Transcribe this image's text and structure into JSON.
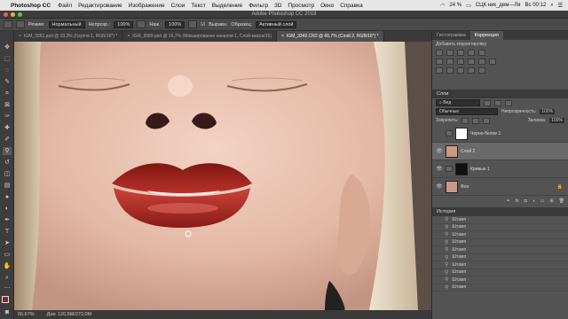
{
  "menubar": {
    "app_name": "Photoshop CC",
    "items": [
      "Файл",
      "Редактирование",
      "Изображение",
      "Слои",
      "Текст",
      "Выделение",
      "Фильтр",
      "3D",
      "Просмотр",
      "Окно",
      "Справка"
    ],
    "battery": "24 %",
    "user": "СЦК ник_дем—Ля",
    "clock": "Вс 00:12"
  },
  "window_title": "Adobe Photoshop CC 2019",
  "options": {
    "mode_label": "Режим:",
    "mode_value": "Нормальный",
    "opacity_label": "Непрозр.:",
    "opacity_value": "100%",
    "pressure_label": "Наж.:",
    "pressure_value": "100%",
    "align_label": "Выравн.",
    "sample_label": "Образец:",
    "sample_value": "Активный слой"
  },
  "tabs": [
    {
      "label": "IGM_3361.psd @ 33,3% (Группа 1, RGB/16*) *"
    },
    {
      "label": "IGM_3589.psd @ 16,7% (Микширование каналов 1, Слой-маска/16)"
    },
    {
      "label": "IGM_3342.CR2 @ 66,7% (Слой 2, RGB/16*) *"
    }
  ],
  "status": {
    "zoom": "66,67%",
    "doc": "Док: 120,5M/272,0M"
  },
  "adjust_panel": {
    "tab1": "Гистограмма",
    "tab2": "Коррекция",
    "subtitle": "Добавить корректировку"
  },
  "layers_panel": {
    "title": "Слои",
    "search": "Вид",
    "blend": "Обычные",
    "opacity_label": "Непрозрачность:",
    "opacity_value": "100%",
    "lock_label": "Закрепить:",
    "fill_label": "Заливка:",
    "fill_value": "100%",
    "layers": [
      {
        "name": "Черно-белое 1"
      },
      {
        "name": "Слой 2"
      },
      {
        "name": "Кривые 1"
      },
      {
        "name": "Фон"
      }
    ]
  },
  "history_panel": {
    "title": "История",
    "items": [
      "Штамп",
      "Штамп",
      "Штамп",
      "Штамп",
      "Штамп",
      "Штамп",
      "Штамп",
      "Штамп",
      "Штамп",
      "Штамп"
    ]
  },
  "colors": {
    "accent": "#2d8ceb",
    "panel_bg": "#535353",
    "lip": "#a8201c",
    "skin": "#e8c2b0"
  }
}
